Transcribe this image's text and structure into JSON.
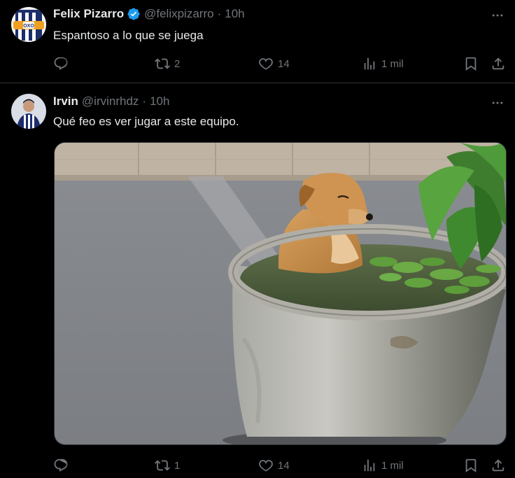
{
  "tweets": [
    {
      "name": "Felix Pizarro",
      "handle": "@felixpizarro",
      "separator": "·",
      "time": "10h",
      "text": "Espantoso a lo que se juega",
      "verified": true,
      "replies": "",
      "retweets": "2",
      "likes": "14",
      "views": "1 mil"
    },
    {
      "name": "Irvin",
      "handle": "@irvinrhdz",
      "separator": "·",
      "time": "10h",
      "text": "Qué feo es ver jugar a este equipo.",
      "verified": false,
      "replies": "",
      "retweets": "1",
      "likes": "14",
      "views": "1 mil",
      "media_description": "dog sitting in a round concrete water planter with lily pads"
    }
  ],
  "icons": {
    "reply": "reply-icon",
    "retweet": "retweet-icon",
    "like": "heart-icon",
    "views": "views-icon",
    "bookmark": "bookmark-icon",
    "share": "share-icon",
    "more": "more-icon",
    "verified": "verified-badge-icon"
  },
  "colors": {
    "background": "#000000",
    "text": "#e7e9ea",
    "secondary": "#71767b",
    "verified": "#1d9bf0",
    "divider": "#2f3336"
  }
}
